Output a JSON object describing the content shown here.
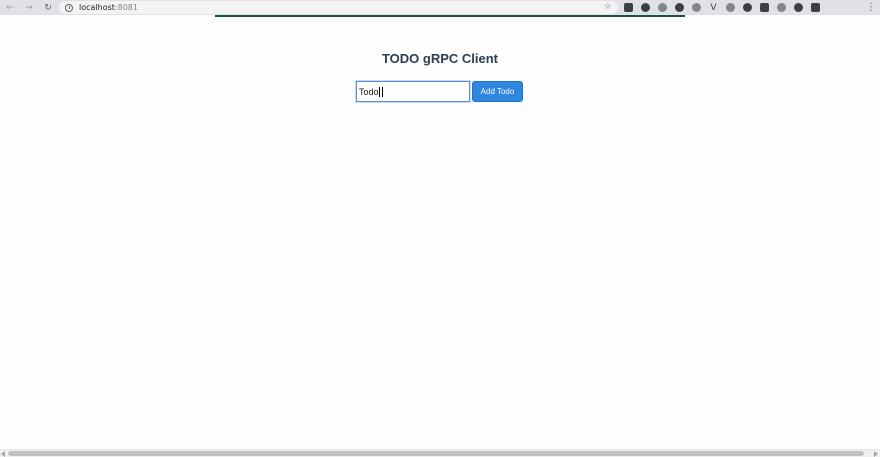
{
  "browser": {
    "url_host": "localhost",
    "url_port": ":8081",
    "icons": {
      "back": "back-arrow-icon",
      "forward": "forward-arrow-icon",
      "reload": "reload-icon",
      "bookmark": "star-icon",
      "menu": "kebab-menu-icon"
    },
    "colors": {
      "toolbar": "#dfe1e5",
      "omnibox": "#f1f3f4"
    }
  },
  "page": {
    "title": "TODO gRPC Client",
    "input_value": "Todo",
    "add_button_label": "Add Todo",
    "colors": {
      "title": "#2c3e50",
      "button": "#2e86de",
      "input_border": "#5a8fd6"
    }
  }
}
